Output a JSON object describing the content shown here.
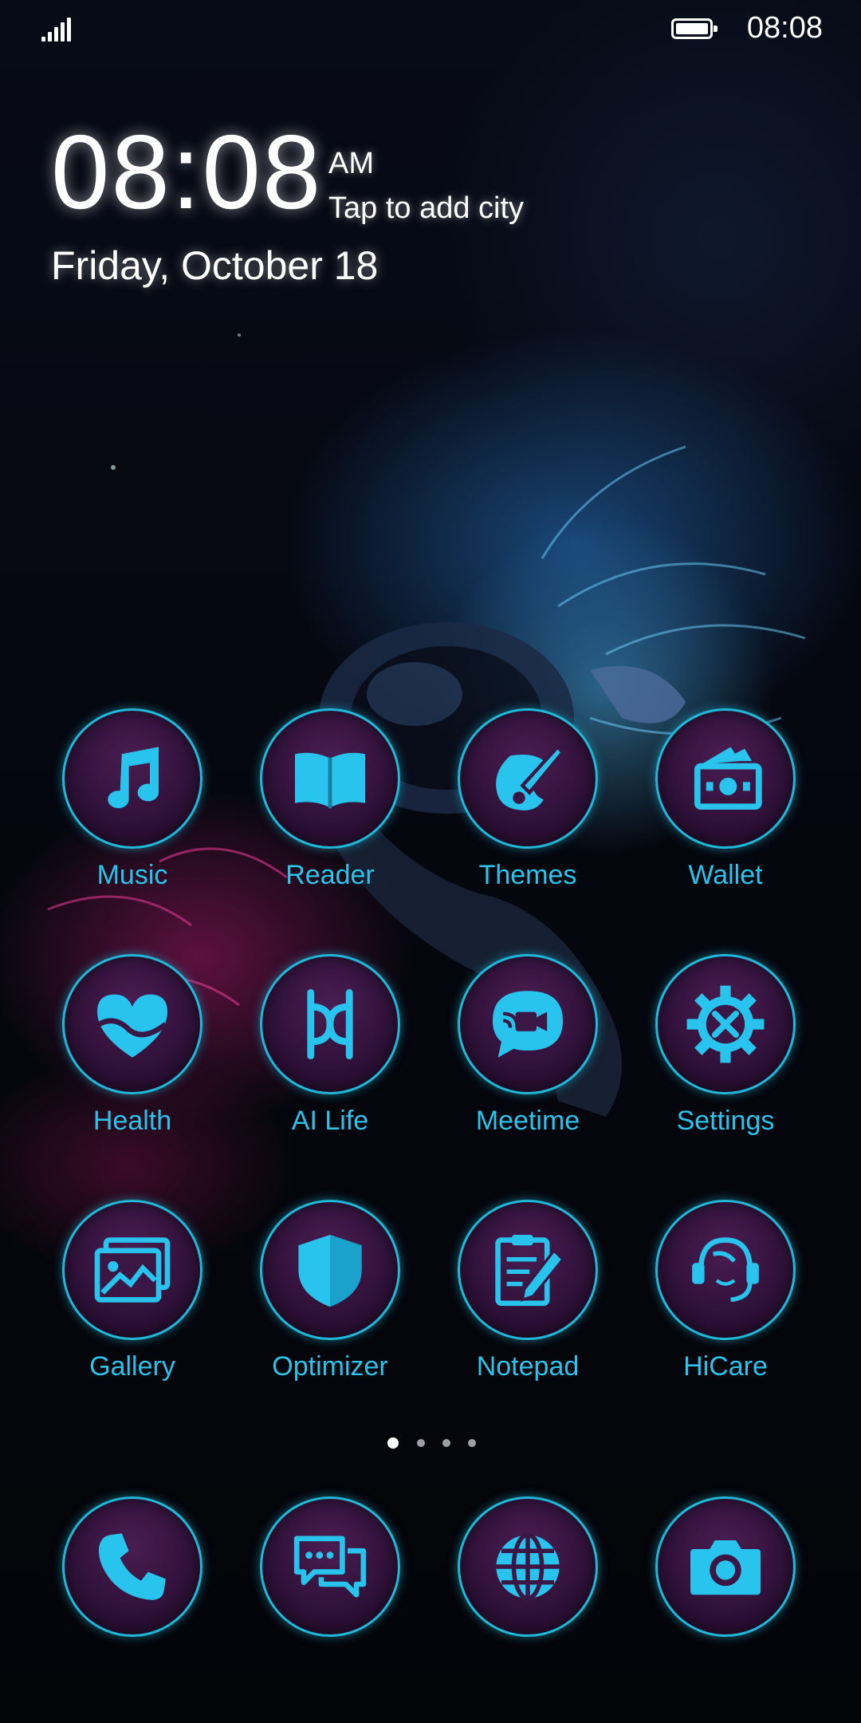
{
  "status_bar": {
    "time": "08:08",
    "signal_icon": "signal-icon",
    "battery_icon": "battery-full-icon"
  },
  "clock_widget": {
    "time": "08:08",
    "ampm": "AM",
    "city_prompt": "Tap to add city",
    "date": "Friday, October 18"
  },
  "apps": [
    {
      "label": "Music",
      "icon": "music-note-icon"
    },
    {
      "label": "Reader",
      "icon": "book-icon"
    },
    {
      "label": "Themes",
      "icon": "brush-icon"
    },
    {
      "label": "Wallet",
      "icon": "wallet-icon"
    },
    {
      "label": "Health",
      "icon": "heart-icon"
    },
    {
      "label": "AI Life",
      "icon": "ai-life-icon"
    },
    {
      "label": "Meetime",
      "icon": "video-chat-icon"
    },
    {
      "label": "Settings",
      "icon": "gear-icon"
    },
    {
      "label": "Gallery",
      "icon": "gallery-icon"
    },
    {
      "label": "Optimizer",
      "icon": "shield-icon"
    },
    {
      "label": "Notepad",
      "icon": "notepad-icon"
    },
    {
      "label": "HiCare",
      "icon": "headset-icon"
    }
  ],
  "page_indicator": {
    "count": 4,
    "active_index": 0
  },
  "dock": [
    {
      "icon": "phone-icon"
    },
    {
      "icon": "messages-icon"
    },
    {
      "icon": "browser-icon"
    },
    {
      "icon": "camera-icon"
    }
  ],
  "colors": {
    "accent": "#2cc3ea",
    "icon_fill": "#29c4ee",
    "bubble": "#3a1744",
    "ring": "#1fb8d8"
  }
}
